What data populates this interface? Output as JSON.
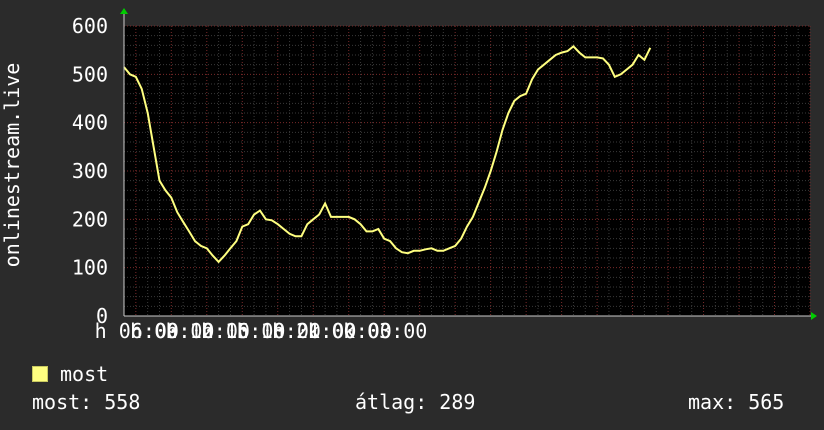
{
  "chart_data": {
    "type": "line",
    "ylabel": "onlinestream.live",
    "ylim": [
      0,
      600
    ],
    "yticks": [
      "0",
      "100",
      "200",
      "300",
      "400",
      "500",
      "600"
    ],
    "xtick_labels": [
      "h 06:00",
      "h 09:00",
      "h 12:00",
      "h 15:00",
      "h 18:00",
      "h 21:00",
      "k 00:00",
      "k 03:00"
    ],
    "grid": true,
    "series": [
      {
        "name": "most",
        "color": "#ffff80",
        "x_hours": [
          0,
          0.5,
          1,
          1.5,
          2,
          2.5,
          3,
          3.5,
          4,
          4.5,
          5,
          5.5,
          6,
          6.5,
          7,
          7.5,
          8,
          8.5,
          9,
          9.5,
          10,
          10.5,
          11,
          11.5,
          12,
          12.5,
          13,
          13.5,
          14,
          14.5,
          15,
          15.5,
          16,
          16.5,
          17,
          17.5,
          18,
          18.5,
          19,
          19.5,
          20,
          20.5,
          21,
          21.5,
          22,
          22.5,
          23,
          23.5,
          24,
          24.5,
          25,
          25.5,
          26,
          26.5,
          27,
          27.5,
          28,
          28.5,
          29,
          29.5,
          30,
          30.5,
          31,
          31.5,
          32,
          32.5,
          33,
          33.5,
          34,
          34.5,
          35,
          35.5,
          36,
          36.5,
          37,
          37.5,
          38,
          38.5,
          39,
          39.5,
          40,
          40.5,
          41,
          41.5,
          42,
          42.5,
          43,
          43.5,
          44,
          44.5,
          45,
          45.5,
          46,
          46.5,
          47,
          47.5,
          48,
          48.5,
          49,
          49.5,
          50,
          50.5,
          51,
          51.5,
          52,
          52.5,
          53,
          53.5,
          54,
          54.5,
          55,
          55.5,
          56,
          56.5,
          57,
          57.5,
          58
        ],
        "values": [
          515,
          500,
          495,
          470,
          420,
          350,
          280,
          260,
          245,
          215,
          195,
          175,
          155,
          145,
          140,
          125,
          112,
          125,
          140,
          155,
          185,
          190,
          210,
          218,
          200,
          198,
          190,
          180,
          170,
          165,
          165,
          190,
          200,
          210,
          233,
          205,
          205,
          205,
          205,
          200,
          190,
          175,
          175,
          180,
          160,
          155,
          140,
          132,
          130,
          135,
          135,
          138,
          140,
          135,
          135,
          140,
          145,
          160,
          185,
          205,
          235,
          265,
          300,
          340,
          385,
          420,
          445,
          455,
          460,
          490,
          510,
          520,
          530,
          540,
          545,
          548,
          558,
          545,
          535,
          535,
          535,
          533,
          520,
          495,
          500,
          510,
          520,
          540,
          530,
          555
        ]
      }
    ],
    "xlim_hours": [
      0,
      58
    ]
  },
  "legend": {
    "label": "most"
  },
  "stats": {
    "current": "most: 558",
    "average": "átlag: 289",
    "max": "max: 565"
  }
}
